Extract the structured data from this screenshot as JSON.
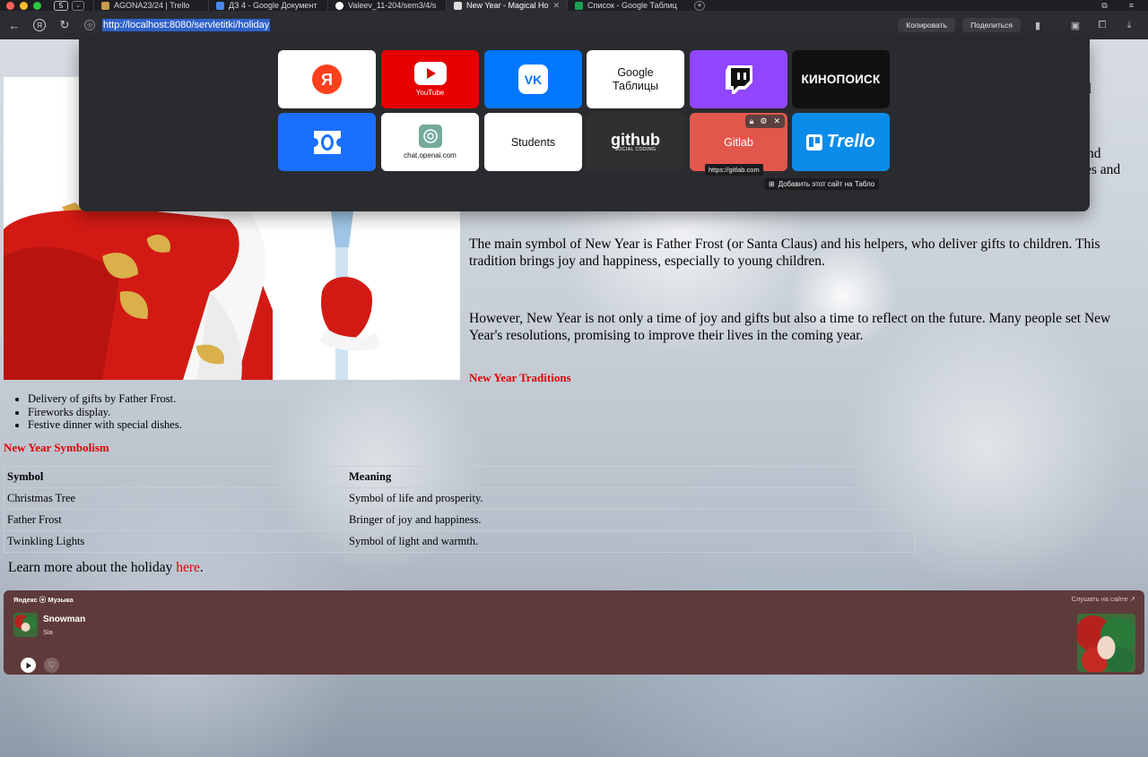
{
  "tabs": {
    "count": "5",
    "items": [
      {
        "label": "AGONA23/24 | Trello",
        "favicon_color": "#c99a4b"
      },
      {
        "label": "ДЗ 4 - Google Документ",
        "favicon_color": "#4a86e8"
      },
      {
        "label": "Valeev_11-204/sem3/4/s",
        "favicon_color": "#ffffff"
      },
      {
        "label": "New Year - Magical Ho",
        "favicon_color": "#dddddd"
      },
      {
        "label": "Список - Google Таблиц",
        "favicon_color": "#1e9f55"
      }
    ]
  },
  "toolbar": {
    "url": "http://localhost:8080/servletitki/holiday",
    "copy_label": "Копировать",
    "share_label": "Поделиться"
  },
  "tablo": {
    "tiles": [
      {
        "name": "yandex",
        "label": "Я",
        "bg": "#ffffff"
      },
      {
        "name": "youtube",
        "label": "YouTube",
        "bg": "#e60000"
      },
      {
        "name": "vk",
        "label": "VK",
        "bg": "#0077ff"
      },
      {
        "name": "google-sheets",
        "label": "Google\nТаблицы",
        "bg": "#ffffff"
      },
      {
        "name": "twitch",
        "label": "",
        "bg": "#9146ff"
      },
      {
        "name": "kinopoisk",
        "label": "КИНОПОИСК",
        "bg": "#111111"
      },
      {
        "name": "yandex-id",
        "label": "",
        "bg": "#1a6fff"
      },
      {
        "name": "chatgpt",
        "label": "chat.openai.com",
        "bg": "#ffffff"
      },
      {
        "name": "students",
        "label": "Students",
        "bg": "#ffffff"
      },
      {
        "name": "github",
        "label": "github",
        "sub": "SOCIAL CODING",
        "bg": "#303030"
      },
      {
        "name": "gitlab",
        "label": "Gitlab",
        "bg": "#e2574c"
      },
      {
        "name": "trello",
        "label": "Trello",
        "bg": "#0c8ce9"
      }
    ],
    "tooltip": "https://gitlab.com",
    "add_site_label": "Добавить этот сайт на Табло"
  },
  "page": {
    "frag1": "d",
    "frag2": "nd",
    "frag3": "es and",
    "para1": "The main symbol of New Year is Father Frost (or Santa Claus) and his helpers, who deliver gifts to children. This tradition brings joy and happiness, especially to young children.",
    "para2": "However, New Year is not only a time of joy and gifts but also a time to reflect on the future. Many people set New Year's resolutions, promising to improve their lives in the coming year.",
    "traditions_title": "New Year Traditions",
    "traditions": [
      "Delivery of gifts by Father Frost.",
      "Fireworks display.",
      "Festive dinner with special dishes."
    ],
    "symbolism_title": "New Year Symbolism",
    "table": {
      "headers": [
        "Symbol",
        "Meaning"
      ],
      "rows": [
        [
          "Christmas Tree",
          "Symbol of life and prosperity."
        ],
        [
          "Father Frost",
          "Bringer of joy and happiness."
        ],
        [
          "Twinkling Lights",
          "Symbol of light and warmth."
        ]
      ]
    },
    "learn_prefix": "Learn more about the holiday ",
    "learn_link": "here",
    "learn_suffix": "."
  },
  "music": {
    "brand": "Яндекс ⦿ Музыка",
    "listen": "Слушать на сайте ↗",
    "song": "Snowman",
    "artist": "Sia"
  }
}
